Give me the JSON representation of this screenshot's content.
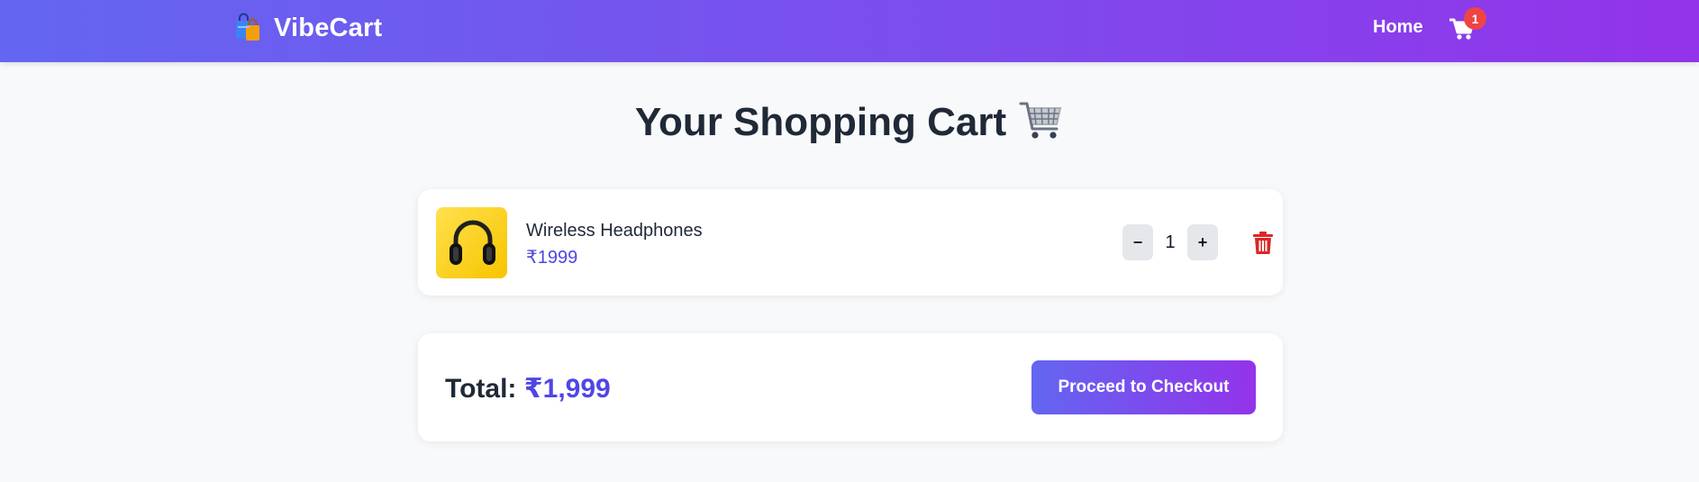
{
  "nav": {
    "brand": "VibeCart",
    "brand_icon": "shopping-bags-icon",
    "home_label": "Home",
    "cart_icon": "cart-icon",
    "cart_count": "1"
  },
  "page": {
    "title": "Your Shopping Cart",
    "title_icon": "shopping-cart-emoji-icon"
  },
  "cart": {
    "items": [
      {
        "name": "Wireless Headphones",
        "price": "₹1999",
        "quantity": "1",
        "image": "headphones-thumbnail",
        "decrement_label": "−",
        "increment_label": "+",
        "remove_icon": "trash-icon"
      }
    ]
  },
  "summary": {
    "total_label": "Total:",
    "total_value": "₹1,999",
    "checkout_label": "Proceed to Checkout"
  },
  "colors": {
    "header_gradient_start": "#6366f1",
    "header_gradient_end": "#9333ea",
    "accent": "#4f46e5",
    "badge": "#ef4444",
    "danger": "#dc2626",
    "background": "#f8f9fb"
  }
}
